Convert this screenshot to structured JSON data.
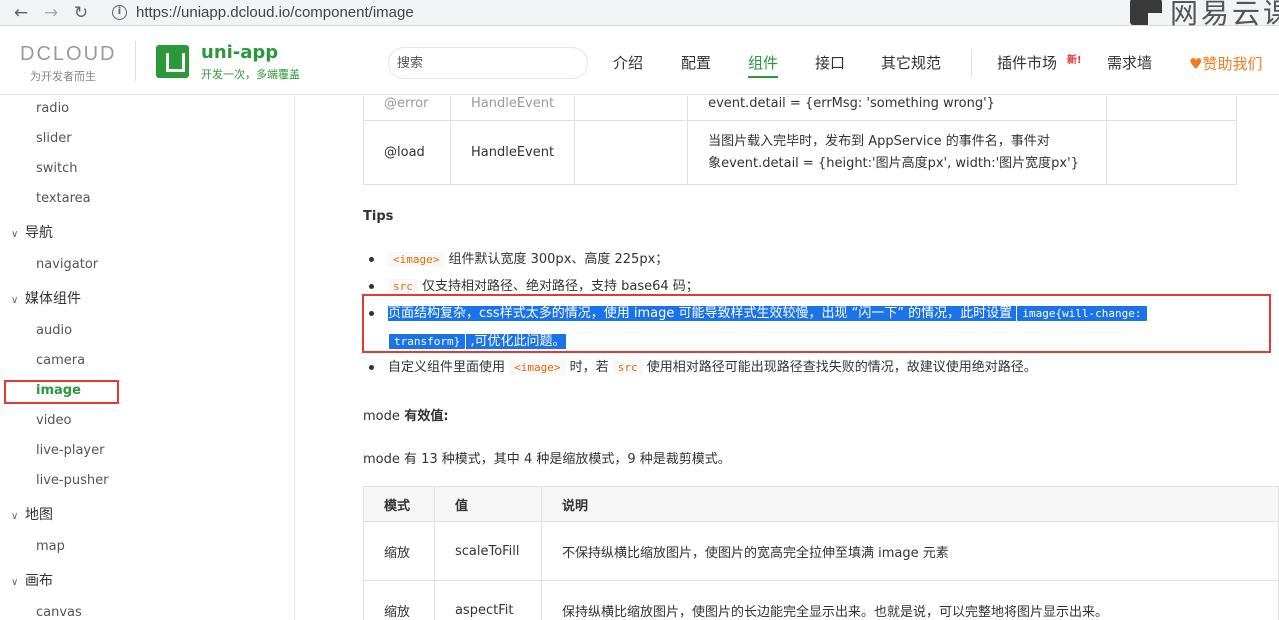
{
  "browser": {
    "back": "←",
    "forward": "→",
    "reload": "↻",
    "url": "https://uniapp.dcloud.io/component/image",
    "watermark": "网易云课"
  },
  "header": {
    "dcloud_name": "DCLOUD",
    "dcloud_slogan": "为开发者而生",
    "uniapp_title": "uni-app",
    "uniapp_subtitle": "开发一次，多端覆盖",
    "search_placeholder": "搜索",
    "nav": [
      "介绍",
      "配置",
      "组件",
      "接口",
      "其它规范",
      "插件市场",
      "需求墙"
    ],
    "active_nav": "组件",
    "new_badge": "新!",
    "sponsor": "赞助我们",
    "sponsor_icon": "♥",
    "accent_color": "#2b9939"
  },
  "sidebar": {
    "items": {
      "radio": "radio",
      "slider": "slider",
      "switch": "switch",
      "textarea": "textarea",
      "navigator": "navigator",
      "audio": "audio",
      "camera": "camera",
      "image": "image",
      "video": "video",
      "live_player": "live-player",
      "live_pusher": "live-pusher",
      "map": "map",
      "canvas": "canvas"
    },
    "groups": {
      "nav": "导航",
      "media": "媒体组件",
      "map": "地图",
      "canvas": "画布"
    },
    "active_item": "image"
  },
  "events_table": {
    "rows": [
      {
        "name": "@error",
        "type": "HandleEvent",
        "desc": "event.detail = {errMsg: 'something wrong'}"
      },
      {
        "name": "@load",
        "type": "HandleEvent",
        "desc_line1": "当图片载入完毕时，发布到 AppService 的事件名，事件对",
        "desc_line2": "象event.detail = {height:'图片高度px', width:'图片宽度px'}"
      }
    ]
  },
  "tips": {
    "title": "Tips",
    "item1_code": "<image>",
    "item1_text": " 组件默认宽度 300px、高度 225px；",
    "item2_code": "src",
    "item2_text": " 仅支持相对路径、绝对路径，支持 base64 码；",
    "item3_text": "页面结构复杂，css样式太多的情况，使用 image 可能导致样式生效较慢，出现 “闪一下” 的情况，此时设置 ",
    "item3_code_a": "image{will-change:",
    "item3_code_b": "transform}",
    "item3_tail": " ,可优化此问题。",
    "item4_pre": "自定义组件里面使用 ",
    "item4_code1": "<image>",
    "item4_mid": " 时，若 ",
    "item4_code2": "src",
    "item4_post": " 使用相对路径可能出现路径查找失败的情况，故建议使用绝对路径。"
  },
  "mode": {
    "title": "mode",
    "title_suffix": " 有效值:",
    "desc": "mode 有 13 种模式，其中 4 种是缩放模式，9 种是裁剪模式。",
    "headers": [
      "模式",
      "值",
      "说明"
    ],
    "rows": [
      {
        "mode": "缩放",
        "value": "scaleToFill",
        "desc": "不保持纵横比缩放图片，使图片的宽高完全拉伸至填满 image 元素"
      },
      {
        "mode": "缩放",
        "value": "aspectFit",
        "desc": "保持纵横比缩放图片，使图片的长边能完全显示出来。也就是说，可以完整地将图片显示出来。"
      }
    ]
  }
}
